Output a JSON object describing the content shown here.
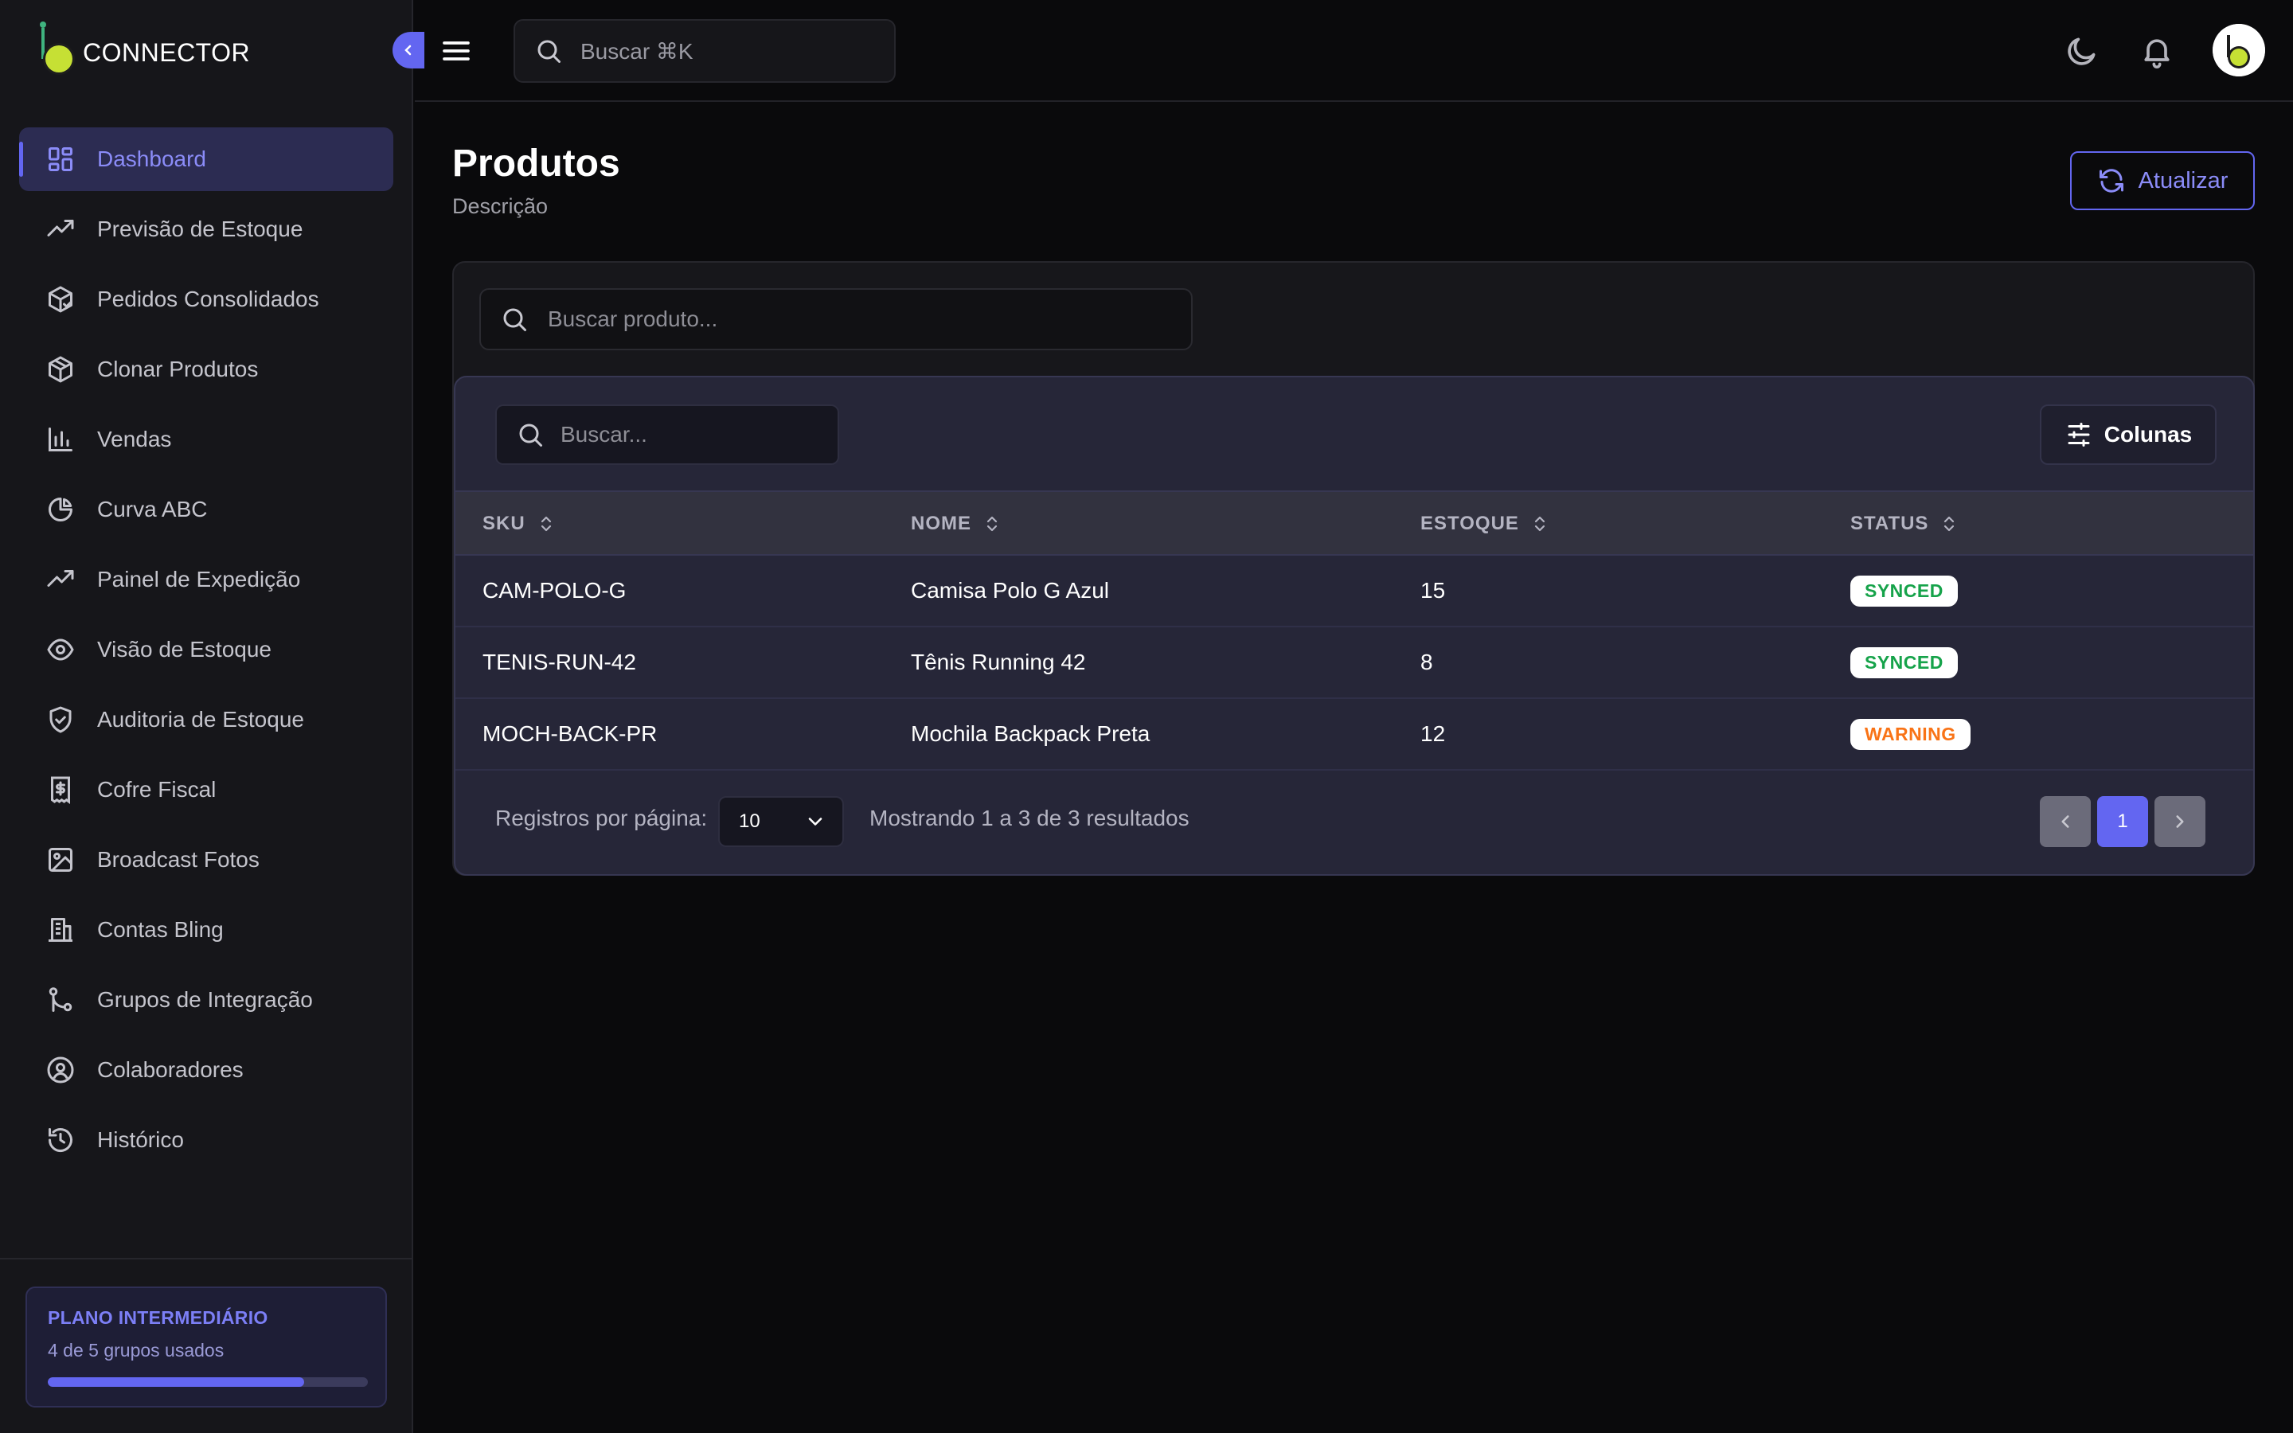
{
  "app": {
    "name": "CONNECTOR"
  },
  "sidebar": {
    "items": [
      {
        "label": "Dashboard",
        "icon": "dashboard-grid-icon",
        "active": true
      },
      {
        "label": "Previsão de Estoque",
        "icon": "trending-up-icon"
      },
      {
        "label": "Pedidos Consolidados",
        "icon": "package-check-icon"
      },
      {
        "label": "Clonar Produtos",
        "icon": "box-icon"
      },
      {
        "label": "Vendas",
        "icon": "bar-chart-icon"
      },
      {
        "label": "Curva ABC",
        "icon": "pie-chart-icon"
      },
      {
        "label": "Painel de Expedição",
        "icon": "trending-up-icon"
      },
      {
        "label": "Visão de Estoque",
        "icon": "eye-icon"
      },
      {
        "label": "Auditoria de Estoque",
        "icon": "shield-check-icon"
      },
      {
        "label": "Cofre Fiscal",
        "icon": "receipt-dollar-icon"
      },
      {
        "label": "Broadcast Fotos",
        "icon": "image-icon"
      },
      {
        "label": "Contas Bling",
        "icon": "building-icon"
      },
      {
        "label": "Grupos de Integração",
        "icon": "git-branch-icon"
      },
      {
        "label": "Colaboradores",
        "icon": "user-circle-icon"
      },
      {
        "label": "Histórico",
        "icon": "history-icon"
      }
    ],
    "plan": {
      "title": "PLANO INTERMEDIÁRIO",
      "usage": "4 de 5 grupos usados",
      "used": 4,
      "total": 5
    }
  },
  "header": {
    "search_placeholder": "Buscar ⌘K"
  },
  "page": {
    "title": "Produtos",
    "description": "Descrição",
    "refresh_label": "Atualizar"
  },
  "card": {
    "product_search_placeholder": "Buscar produto...",
    "table_search_placeholder": "Buscar...",
    "columns_label": "Colunas",
    "columns": [
      "SKU",
      "NOME",
      "ESTOQUE",
      "STATUS"
    ],
    "rows": [
      {
        "sku": "CAM-POLO-G",
        "nome": "Camisa Polo G Azul",
        "estoque": "15",
        "status": "SYNCED"
      },
      {
        "sku": "TENIS-RUN-42",
        "nome": "Tênis Running 42",
        "estoque": "8",
        "status": "SYNCED"
      },
      {
        "sku": "MOCH-BACK-PR",
        "nome": "Mochila Backpack Preta",
        "estoque": "12",
        "status": "WARNING"
      }
    ],
    "footer": {
      "rows_per_page_label": "Registros por página:",
      "rows_per_page_value": "10",
      "showing_text": "Mostrando 1 a 3 de 3 resultados",
      "current_page": "1"
    }
  },
  "colors": {
    "accent": "#6366f1",
    "synced": "#16a34a",
    "warning": "#f97316",
    "logo": "#c6e034"
  }
}
